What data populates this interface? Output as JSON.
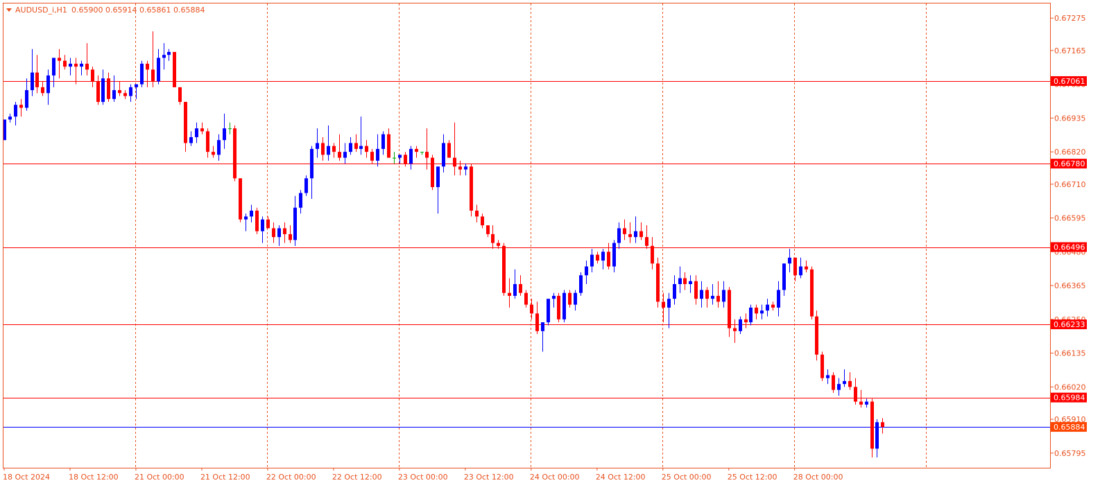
{
  "header": {
    "symbol": "AUDUSD_i,H1",
    "ohlc": "0.65900 0.65914 0.65861 0.65884"
  },
  "colors": {
    "frame": "#e8501e",
    "bull": "#0000ff",
    "bear": "#ff0000",
    "doji": "#00a000",
    "level_line": "#ff0000",
    "bid_line": "#0000ff",
    "label_bg": "#ff0000",
    "bid_label_bg": "#ff4500",
    "grid": "#e8501e"
  },
  "chart_data": {
    "type": "candlestick",
    "symbol": "AUDUSD_i",
    "timeframe": "H1",
    "ylim": [
      0.65745,
      0.67325
    ],
    "y_ticks": [
      "0.67275",
      "0.67165",
      "0.67050",
      "0.66935",
      "0.66820",
      "0.66710",
      "0.66595",
      "0.66480",
      "0.66365",
      "0.66250",
      "0.66135",
      "0.66020",
      "0.65910",
      "0.65795"
    ],
    "x_labels": [
      {
        "text": "18 Oct 2024",
        "bar": 0
      },
      {
        "text": "18 Oct 12:00",
        "bar": 12
      },
      {
        "text": "21 Oct 00:00",
        "bar": 24
      },
      {
        "text": "21 Oct 12:00",
        "bar": 36
      },
      {
        "text": "22 Oct 00:00",
        "bar": 48
      },
      {
        "text": "22 Oct 12:00",
        "bar": 60
      },
      {
        "text": "23 Oct 00:00",
        "bar": 72
      },
      {
        "text": "23 Oct 12:00",
        "bar": 84
      },
      {
        "text": "24 Oct 00:00",
        "bar": 96
      },
      {
        "text": "24 Oct 12:00",
        "bar": 108
      },
      {
        "text": "25 Oct 00:00",
        "bar": 120
      },
      {
        "text": "25 Oct 12:00",
        "bar": 132
      },
      {
        "text": "28 Oct 00:00",
        "bar": 144
      }
    ],
    "vgrid_bars": [
      24,
      48,
      72,
      96,
      120,
      144,
      168
    ],
    "levels": [
      {
        "label": "0.67061",
        "value": 0.67061
      },
      {
        "label": "0.66780",
        "value": 0.6678
      },
      {
        "label": "0.66496",
        "value": 0.66496
      },
      {
        "label": "0.66233",
        "value": 0.66233
      },
      {
        "label": "0.65984",
        "value": 0.65984
      }
    ],
    "bid": {
      "label": "0.65884",
      "value": 0.65884
    },
    "candles": [
      [
        0.6686,
        0.6693,
        0.6686,
        0.6693
      ],
      [
        0.6693,
        0.6695,
        0.6692,
        0.6694
      ],
      [
        0.6694,
        0.6699,
        0.6691,
        0.6698
      ],
      [
        0.6698,
        0.67,
        0.6694,
        0.6697
      ],
      [
        0.6697,
        0.6707,
        0.6696,
        0.6703
      ],
      [
        0.6703,
        0.6717,
        0.6701,
        0.6709
      ],
      [
        0.6709,
        0.6715,
        0.6702,
        0.6704
      ],
      [
        0.6704,
        0.6706,
        0.6701,
        0.6702
      ],
      [
        0.6702,
        0.671,
        0.6698,
        0.6708
      ],
      [
        0.6708,
        0.6713,
        0.6704,
        0.6714
      ],
      [
        0.6714,
        0.6717,
        0.6707,
        0.6713
      ],
      [
        0.6713,
        0.6715,
        0.671,
        0.6711
      ],
      [
        0.6711,
        0.6714,
        0.6708,
        0.6712
      ],
      [
        0.6712,
        0.6714,
        0.6705,
        0.6711
      ],
      [
        0.6711,
        0.6713,
        0.6708,
        0.6712
      ],
      [
        0.6712,
        0.6719,
        0.6708,
        0.671
      ],
      [
        0.671,
        0.6711,
        0.6704,
        0.6706
      ],
      [
        0.6706,
        0.6708,
        0.6698,
        0.6699
      ],
      [
        0.6699,
        0.671,
        0.6698,
        0.6707
      ],
      [
        0.6707,
        0.6709,
        0.6699,
        0.67
      ],
      [
        0.67,
        0.6708,
        0.6699,
        0.6703
      ],
      [
        0.6703,
        0.6706,
        0.6701,
        0.6702
      ],
      [
        0.6702,
        0.6703,
        0.67,
        0.6701
      ],
      [
        0.6701,
        0.6705,
        0.6699,
        0.6704
      ],
      [
        0.6704,
        0.6705,
        0.67,
        0.6705
      ],
      [
        0.6705,
        0.6713,
        0.6704,
        0.6712
      ],
      [
        0.6712,
        0.6713,
        0.6704,
        0.671
      ],
      [
        0.671,
        0.6723,
        0.6704,
        0.6706
      ],
      [
        0.6706,
        0.6717,
        0.6705,
        0.6714
      ],
      [
        0.6714,
        0.6719,
        0.671,
        0.6715
      ],
      [
        0.6715,
        0.6717,
        0.6713,
        0.6716
      ],
      [
        0.6716,
        0.6716,
        0.6704,
        0.6704
      ],
      [
        0.6704,
        0.6704,
        0.6698,
        0.6699
      ],
      [
        0.6699,
        0.6699,
        0.6682,
        0.6685
      ],
      [
        0.6685,
        0.6689,
        0.6684,
        0.6687
      ],
      [
        0.6687,
        0.6692,
        0.6685,
        0.669
      ],
      [
        0.669,
        0.6692,
        0.6688,
        0.6689
      ],
      [
        0.6689,
        0.669,
        0.668,
        0.6682
      ],
      [
        0.6682,
        0.6684,
        0.668,
        0.6681
      ],
      [
        0.6681,
        0.6688,
        0.6679,
        0.6686
      ],
      [
        0.6686,
        0.6695,
        0.6683,
        0.669
      ],
      [
        0.669,
        0.6692,
        0.6688,
        0.669
      ],
      [
        0.669,
        0.6691,
        0.6672,
        0.6673
      ],
      [
        0.6673,
        0.6673,
        0.6658,
        0.6659
      ],
      [
        0.6659,
        0.6661,
        0.6655,
        0.666
      ],
      [
        0.666,
        0.6664,
        0.6658,
        0.6662
      ],
      [
        0.6662,
        0.6663,
        0.6654,
        0.6655
      ],
      [
        0.6655,
        0.666,
        0.6651,
        0.6659
      ],
      [
        0.6659,
        0.666,
        0.6657,
        0.6656
      ],
      [
        0.6656,
        0.6658,
        0.6651,
        0.6653
      ],
      [
        0.6653,
        0.6657,
        0.665,
        0.6656
      ],
      [
        0.6656,
        0.6658,
        0.6651,
        0.6654
      ],
      [
        0.6654,
        0.6657,
        0.6651,
        0.6652
      ],
      [
        0.6652,
        0.6667,
        0.665,
        0.6663
      ],
      [
        0.6663,
        0.6669,
        0.6661,
        0.6668
      ],
      [
        0.6668,
        0.6674,
        0.6667,
        0.6673
      ],
      [
        0.6673,
        0.6684,
        0.6666,
        0.6683
      ],
      [
        0.6683,
        0.669,
        0.668,
        0.6685
      ],
      [
        0.6685,
        0.6687,
        0.6679,
        0.6681
      ],
      [
        0.6681,
        0.6691,
        0.6679,
        0.6684
      ],
      [
        0.6684,
        0.6685,
        0.668,
        0.6682
      ],
      [
        0.6682,
        0.6688,
        0.6679,
        0.668
      ],
      [
        0.668,
        0.6685,
        0.6678,
        0.6682
      ],
      [
        0.6682,
        0.6687,
        0.6681,
        0.6685
      ],
      [
        0.6685,
        0.6688,
        0.6682,
        0.6683
      ],
      [
        0.6683,
        0.6694,
        0.6681,
        0.6684
      ],
      [
        0.6684,
        0.6686,
        0.668,
        0.6682
      ],
      [
        0.6682,
        0.6683,
        0.6678,
        0.6679
      ],
      [
        0.6679,
        0.6688,
        0.6677,
        0.6683
      ],
      [
        0.6683,
        0.6689,
        0.6681,
        0.6688
      ],
      [
        0.6688,
        0.669,
        0.668,
        0.668
      ],
      [
        0.668,
        0.6682,
        0.6678,
        0.668
      ],
      [
        0.668,
        0.6681,
        0.6678,
        0.6681
      ],
      [
        0.6681,
        0.6682,
        0.6677,
        0.6678
      ],
      [
        0.6678,
        0.6684,
        0.6676,
        0.6683
      ],
      [
        0.6683,
        0.6684,
        0.668,
        0.6682
      ],
      [
        0.6682,
        0.6682,
        0.6681,
        0.6682
      ],
      [
        0.6682,
        0.669,
        0.6676,
        0.668
      ],
      [
        0.668,
        0.6681,
        0.6669,
        0.667
      ],
      [
        0.667,
        0.6677,
        0.6661,
        0.6677
      ],
      [
        0.6677,
        0.6688,
        0.6675,
        0.6685
      ],
      [
        0.6685,
        0.6686,
        0.668,
        0.668
      ],
      [
        0.668,
        0.6692,
        0.6674,
        0.6677
      ],
      [
        0.6677,
        0.6679,
        0.6674,
        0.6676
      ],
      [
        0.6676,
        0.6678,
        0.6674,
        0.6677
      ],
      [
        0.6677,
        0.6678,
        0.666,
        0.6662
      ],
      [
        0.6662,
        0.6664,
        0.6658,
        0.666
      ],
      [
        0.666,
        0.6661,
        0.6656,
        0.6657
      ],
      [
        0.6657,
        0.6657,
        0.6653,
        0.6654
      ],
      [
        0.6654,
        0.6657,
        0.6649,
        0.6651
      ],
      [
        0.6651,
        0.6652,
        0.6649,
        0.665
      ],
      [
        0.665,
        0.6651,
        0.6633,
        0.6634
      ],
      [
        0.6634,
        0.6639,
        0.6629,
        0.6633
      ],
      [
        0.6633,
        0.6642,
        0.6632,
        0.6637
      ],
      [
        0.6637,
        0.664,
        0.6633,
        0.6634
      ],
      [
        0.6634,
        0.6635,
        0.6629,
        0.663
      ],
      [
        0.663,
        0.6632,
        0.6625,
        0.6627
      ],
      [
        0.6627,
        0.6631,
        0.662,
        0.6621
      ],
      [
        0.6621,
        0.6624,
        0.6614,
        0.6624
      ],
      [
        0.6624,
        0.6629,
        0.6623,
        0.6632
      ],
      [
        0.6632,
        0.6634,
        0.6629,
        0.6633
      ],
      [
        0.6633,
        0.6634,
        0.6624,
        0.6625
      ],
      [
        0.6625,
        0.6635,
        0.6624,
        0.6634
      ],
      [
        0.6634,
        0.6635,
        0.6629,
        0.663
      ],
      [
        0.663,
        0.6635,
        0.6628,
        0.6634
      ],
      [
        0.6634,
        0.6641,
        0.6633,
        0.664
      ],
      [
        0.664,
        0.6645,
        0.6637,
        0.6643
      ],
      [
        0.6643,
        0.6649,
        0.6641,
        0.6647
      ],
      [
        0.6647,
        0.6648,
        0.6644,
        0.6645
      ],
      [
        0.6645,
        0.6649,
        0.6642,
        0.6648
      ],
      [
        0.6648,
        0.6651,
        0.6642,
        0.6643
      ],
      [
        0.6643,
        0.6652,
        0.6641,
        0.6651
      ],
      [
        0.6651,
        0.6658,
        0.6649,
        0.6656
      ],
      [
        0.6656,
        0.6659,
        0.6652,
        0.6654
      ],
      [
        0.6654,
        0.6658,
        0.6651,
        0.6653
      ],
      [
        0.6653,
        0.666,
        0.6651,
        0.6655
      ],
      [
        0.6655,
        0.6658,
        0.6652,
        0.6653
      ],
      [
        0.6653,
        0.6657,
        0.6649,
        0.665
      ],
      [
        0.665,
        0.6653,
        0.6642,
        0.6644
      ],
      [
        0.6644,
        0.6646,
        0.6629,
        0.6631
      ],
      [
        0.6631,
        0.6634,
        0.6624,
        0.6629
      ],
      [
        0.6629,
        0.6634,
        0.6622,
        0.6632
      ],
      [
        0.6632,
        0.664,
        0.663,
        0.6637
      ],
      [
        0.6637,
        0.6643,
        0.6634,
        0.6639
      ],
      [
        0.6639,
        0.6641,
        0.6635,
        0.6637
      ],
      [
        0.6637,
        0.664,
        0.6634,
        0.6638
      ],
      [
        0.6638,
        0.664,
        0.663,
        0.6632
      ],
      [
        0.6632,
        0.6638,
        0.6629,
        0.6635
      ],
      [
        0.6635,
        0.6636,
        0.6629,
        0.6632
      ],
      [
        0.6632,
        0.6637,
        0.663,
        0.6633
      ],
      [
        0.6633,
        0.6638,
        0.6629,
        0.6631
      ],
      [
        0.6631,
        0.6638,
        0.6629,
        0.6635
      ],
      [
        0.6635,
        0.6636,
        0.6619,
        0.6622
      ],
      [
        0.6622,
        0.6625,
        0.6617,
        0.6621
      ],
      [
        0.6621,
        0.6626,
        0.662,
        0.6625
      ],
      [
        0.6625,
        0.6627,
        0.6622,
        0.6624
      ],
      [
        0.6624,
        0.663,
        0.6623,
        0.6629
      ],
      [
        0.6629,
        0.663,
        0.6625,
        0.6627
      ],
      [
        0.6627,
        0.663,
        0.6625,
        0.6628
      ],
      [
        0.6628,
        0.6632,
        0.6626,
        0.663
      ],
      [
        0.663,
        0.6631,
        0.6628,
        0.6629
      ],
      [
        0.6629,
        0.6638,
        0.6626,
        0.6635
      ],
      [
        0.6635,
        0.6644,
        0.6633,
        0.6644
      ],
      [
        0.6644,
        0.6649,
        0.6641,
        0.6646
      ],
      [
        0.6646,
        0.6646,
        0.6638,
        0.664
      ],
      [
        0.664,
        0.6646,
        0.6639,
        0.6643
      ],
      [
        0.6643,
        0.6645,
        0.6641,
        0.6642
      ],
      [
        0.6642,
        0.6643,
        0.6625,
        0.6626
      ],
      [
        0.6626,
        0.6628,
        0.6611,
        0.6613
      ],
      [
        0.6613,
        0.6614,
        0.6604,
        0.6605
      ],
      [
        0.6605,
        0.6608,
        0.6603,
        0.6606
      ],
      [
        0.6606,
        0.6607,
        0.66,
        0.6601
      ],
      [
        0.6601,
        0.6605,
        0.6599,
        0.6603
      ],
      [
        0.6603,
        0.6608,
        0.6602,
        0.6604
      ],
      [
        0.6604,
        0.6607,
        0.6601,
        0.6602
      ],
      [
        0.6602,
        0.6605,
        0.6596,
        0.6597
      ],
      [
        0.6597,
        0.6601,
        0.6595,
        0.6596
      ],
      [
        0.6596,
        0.6598,
        0.6595,
        0.6597
      ],
      [
        0.6597,
        0.6598,
        0.6578,
        0.6581
      ],
      [
        0.6581,
        0.6591,
        0.6578,
        0.659
      ],
      [
        0.659,
        0.65914,
        0.65861,
        0.65884
      ]
    ]
  }
}
